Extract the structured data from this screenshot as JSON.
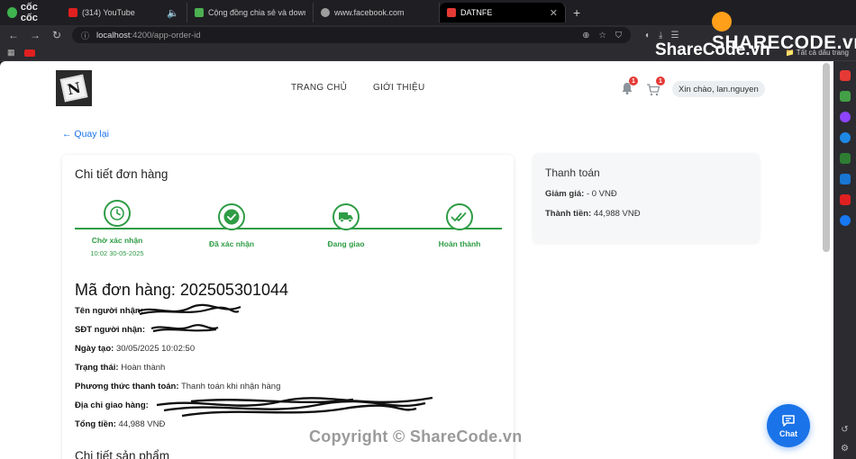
{
  "browser": {
    "brand": "cốc cốc",
    "tabs": [
      {
        "title": "(314) YouTube",
        "fav_color": "#e02020"
      },
      {
        "title": "Cộng đồng chia sẻ và download",
        "fav_color": "#4caf50"
      },
      {
        "title": "www.facebook.com",
        "fav_color": "#9e9e9e"
      },
      {
        "title": "DATNFE",
        "fav_color": "#e53935",
        "active": true
      }
    ],
    "url_host": "localhost",
    "url_path": ":4200/app-order-id",
    "bookmarks_all": "Tất cả dấu trang"
  },
  "watermarks": {
    "logo": "SHARECODE.vn",
    "site": "ShareCode.vn",
    "copyright": "Copyright © ShareCode.vn"
  },
  "header": {
    "logo_letter": "N",
    "menu": {
      "home": "TRANG CHỦ",
      "about": "GIỚI THIỆU"
    },
    "notif_count": "1",
    "cart_count": "1",
    "greeting": "Xin chào, lan.nguyen"
  },
  "back_link": "← Quay lại",
  "order": {
    "title": "Chi tiết đơn hàng",
    "steps": [
      {
        "label": "Chờ xác nhận",
        "time": "10:02 30-05-2025",
        "icon": "clock-icon"
      },
      {
        "label": "Đã xác nhận",
        "time": "",
        "icon": "check-circle-icon"
      },
      {
        "label": "Đang giao",
        "time": "",
        "icon": "truck-icon"
      },
      {
        "label": "Hoàn thành",
        "time": "",
        "icon": "double-check-icon"
      }
    ],
    "code_label": "Mã đơn hàng: 202505301044",
    "fields": [
      {
        "label": "Tên người nhận:",
        "value": ""
      },
      {
        "label": "SĐT người nhận:",
        "value": ""
      },
      {
        "label": "Ngày tạo:",
        "value": "30/05/2025 10:02:50"
      },
      {
        "label": "Trạng thái:",
        "value": "Hoàn thành"
      },
      {
        "label": "Phương thức thanh toán:",
        "value": "Thanh toán khi nhận hàng"
      },
      {
        "label": "Địa chỉ giao hàng:",
        "value": ""
      },
      {
        "label": "Tổng tiền:",
        "value": "44,988 VNĐ"
      }
    ],
    "products_title": "Chi tiết sản phẩm"
  },
  "payment": {
    "title": "Thanh toán",
    "discount_label": "Giảm giá:",
    "discount_value": "- 0 VNĐ",
    "total_label": "Thành tiền:",
    "total_value": "44,988 VNĐ"
  },
  "chat": {
    "label": "Chat"
  },
  "colors": {
    "accent": "#2e9c45",
    "link": "#1a73e8",
    "badge": "#e53935"
  }
}
